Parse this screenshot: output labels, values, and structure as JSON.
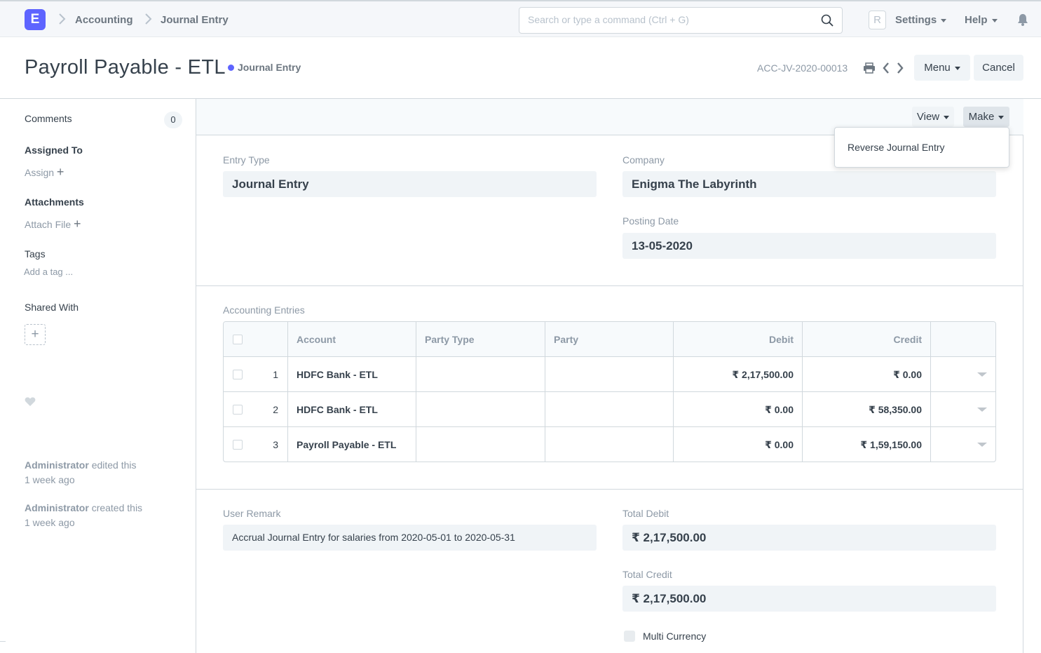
{
  "navbar": {
    "logo_letter": "E",
    "breadcrumbs": [
      "Accounting",
      "Journal Entry"
    ],
    "search_placeholder": "Search or type a command (Ctrl + G)",
    "avatar_letter": "R",
    "settings_label": "Settings",
    "help_label": "Help"
  },
  "header": {
    "title": "Payroll Payable - ETL",
    "status": "Journal Entry",
    "status_color": "#5e64ff",
    "doc_id": "ACC-JV-2020-00013",
    "menu_label": "Menu",
    "cancel_label": "Cancel"
  },
  "sidebar": {
    "comments_label": "Comments",
    "comments_count": "0",
    "assigned_to_label": "Assigned To",
    "assign_label": "Assign",
    "attachments_label": "Attachments",
    "attach_file_label": "Attach File",
    "tags_label": "Tags",
    "add_tag_label": "Add a tag ...",
    "shared_with_label": "Shared With",
    "activity": [
      {
        "user": "Administrator",
        "action": "edited this",
        "time": "1 week ago"
      },
      {
        "user": "Administrator",
        "action": "created this",
        "time": "1 week ago"
      }
    ]
  },
  "toolbar": {
    "view_label": "View",
    "make_label": "Make",
    "make_menu_items": [
      "Reverse Journal Entry"
    ]
  },
  "form": {
    "entry_type_label": "Entry Type",
    "entry_type_value": "Journal Entry",
    "company_label": "Company",
    "company_value": "Enigma The Labyrinth",
    "posting_date_label": "Posting Date",
    "posting_date_value": "13-05-2020",
    "accounting_entries_label": "Accounting Entries",
    "user_remark_label": "User Remark",
    "user_remark_value": "Accrual Journal Entry for salaries from 2020-05-01 to 2020-05-31",
    "total_debit_label": "Total Debit",
    "total_debit_value": "₹ 2,17,500.00",
    "total_credit_label": "Total Credit",
    "total_credit_value": "₹ 2,17,500.00",
    "multi_currency_label": "Multi Currency"
  },
  "entries_table": {
    "columns": [
      "Account",
      "Party Type",
      "Party",
      "Debit",
      "Credit"
    ],
    "rows": [
      {
        "idx": "1",
        "account": "HDFC Bank - ETL",
        "party_type": "",
        "party": "",
        "debit": "₹ 2,17,500.00",
        "credit": "₹ 0.00"
      },
      {
        "idx": "2",
        "account": "HDFC Bank - ETL",
        "party_type": "",
        "party": "",
        "debit": "₹ 0.00",
        "credit": "₹ 58,350.00"
      },
      {
        "idx": "3",
        "account": "Payroll Payable - ETL",
        "party_type": "",
        "party": "",
        "debit": "₹ 0.00",
        "credit": "₹ 1,59,150.00"
      }
    ]
  }
}
